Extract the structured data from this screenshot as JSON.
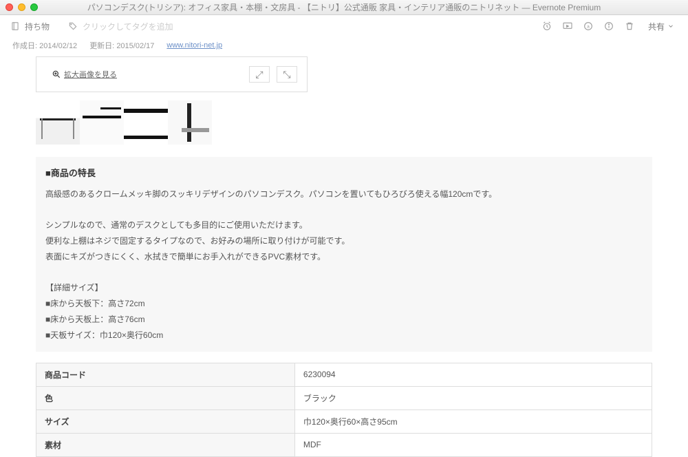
{
  "window": {
    "title": "パソコンデスク(トリシア): オフィス家具・本棚・文房具 - 【ニトリ】公式通販 家具・インテリア通販のニトリネット — Evernote Premium"
  },
  "toolbar": {
    "notebook": "持ち物",
    "tag_placeholder": "クリックしてタグを追加",
    "share_label": "共有"
  },
  "meta": {
    "created_label": "作成日:",
    "created_value": "2014/02/12",
    "updated_label": "更新日:",
    "updated_value": "2015/02/17",
    "source_url": "www.nitori-net.jp"
  },
  "preview": {
    "zoom_label": "拡大画像を見る"
  },
  "features": {
    "heading": "■商品の特長",
    "p1": "高級感のあるクロームメッキ脚のスッキリデザインのパソコンデスク。パソコンを置いてもひろびろ使える幅120cmです。",
    "p2": "シンプルなので、通常のデスクとしても多目的にご使用いただけます。",
    "p3": "便利な上棚はネジで固定するタイプなので、お好みの場所に取り付けが可能です。",
    "p4": "表面にキズがつきにくく、水拭きで簡単にお手入れができるPVC素材です。",
    "detail_head": "【詳細サイズ】",
    "d1": "■床から天板下：高さ72cm",
    "d2": "■床から天板上：高さ76cm",
    "d3": "■天板サイズ：巾120×奥行60cm"
  },
  "spec": {
    "rows": [
      {
        "label": "商品コード",
        "value": "6230094"
      },
      {
        "label": "色",
        "value": "ブラック"
      },
      {
        "label": "サイズ",
        "value": "巾120×奥行60×高さ95cm"
      },
      {
        "label": "素材",
        "value": "MDF"
      }
    ]
  }
}
